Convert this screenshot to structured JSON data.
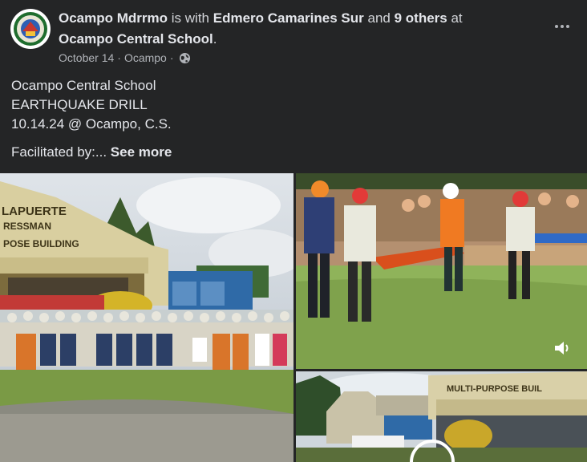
{
  "post": {
    "author": "Ocampo Mdrrmo",
    "with_text": "is with",
    "tagged": "Edmero Camarines Sur",
    "and_text": "and",
    "others": "9 others",
    "at_text": "at",
    "location": "Ocampo Central School",
    "location_period": ".",
    "date": "October 14",
    "separator": "·",
    "place": "Ocampo",
    "privacy_icon": "globe-icon",
    "more_icon": "more-options-icon"
  },
  "body": {
    "lines": [
      "Ocampo Central School",
      "EARTHQUAKE DRILL",
      "10.14.24 @ Ocampo, C.S."
    ],
    "facilitated": "Facilitated by:...",
    "see_more": "See more"
  },
  "photos": {
    "main_building_sign_1": "LAPUERTE",
    "main_building_sign_2": "RESSMAN",
    "main_building_sign_3": "POSE BUILDING",
    "video_building_sign": "MULTI-PURPOSE BUIL",
    "sound_icon": "speaker-icon"
  },
  "colors": {
    "background": "#242526",
    "text_primary": "#e4e6eb",
    "text_secondary": "#b0b3b8"
  }
}
